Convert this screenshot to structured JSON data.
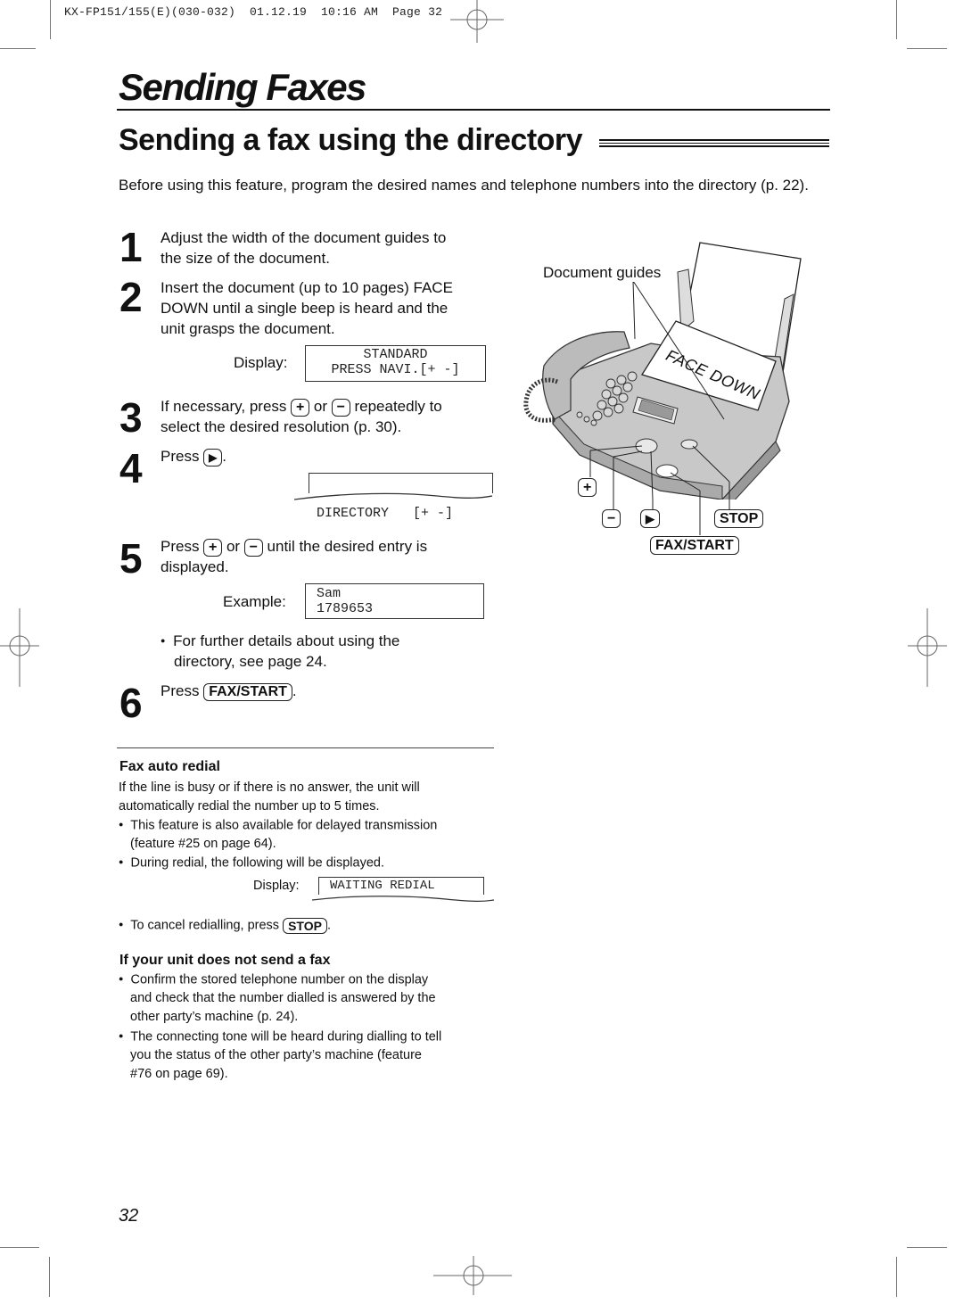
{
  "print_header": "KX-FP151/155(E)(030-032)  01.12.19  10:16 AM  Page 32",
  "page_title": "Sending Faxes",
  "section_title": "Sending a fax using the directory",
  "intro": "Before using this feature, program the desired names and telephone numbers into the directory (p. 22).",
  "steps": [
    {
      "number": "1",
      "text_lines": [
        "Adjust the width of the document guides to",
        "the size of the document."
      ]
    },
    {
      "number": "2",
      "text_lines": [
        "Insert the document (up to 10 pages) FACE",
        "DOWN until a single beep is heard and the",
        "unit grasps the document."
      ],
      "display_label": "Display:",
      "display_lines": [
        "STANDARD",
        "PRESS NAVI.[+ -]"
      ]
    },
    {
      "number": "3",
      "text_pre": "If necessary, press",
      "key1": "+",
      "text_mid": "or",
      "key2": "−",
      "text_post": "repeatedly to",
      "text_line2": "select the desired resolution (p. 30)."
    },
    {
      "number": "4",
      "text_pre": "Press",
      "key": "▶",
      "text_post": ".",
      "display_lines": [
        "DIRECTORY   [+ -]"
      ]
    },
    {
      "number": "5",
      "text_pre": "Press",
      "key1": "+",
      "text_mid": "or",
      "key2": "−",
      "text_post": "until the desired entry is",
      "text_line2": "displayed.",
      "example_label": "Example:",
      "display_lines": [
        "Sam",
        "1789653"
      ],
      "bullet_lines": [
        "For further details about using the",
        "directory, see page 24."
      ]
    },
    {
      "number": "6",
      "text_pre": "Press",
      "key": "FAX/START",
      "text_post": "."
    }
  ],
  "figure": {
    "callout_document_guides": "Document guides",
    "paper_text": "FACE DOWN",
    "keys": {
      "plus": "+",
      "minus": "−",
      "navi_right": "▶",
      "stop": "STOP",
      "fax_start": "FAX/START"
    }
  },
  "fax_auto_redial": {
    "heading": "Fax auto redial",
    "body_lines": [
      "If the line is busy or if there is no answer, the unit will",
      "automatically redial the number up to 5 times."
    ],
    "bullet1_lines": [
      "This feature is also available for delayed transmission",
      "(feature #25 on page 64)."
    ],
    "bullet2": "During redial, the following will be displayed.",
    "display_label": "Display:",
    "display_text": "WAITING REDIAL",
    "bullet3_pre": "To cancel redialling, press",
    "bullet3_key": "STOP",
    "bullet3_post": "."
  },
  "troubleshoot": {
    "heading": "If your unit does not send a fax",
    "bullet1_lines": [
      "Confirm the stored telephone number on the display",
      "and check that the number dialled is answered by the",
      "other party’s machine (p. 24)."
    ],
    "bullet2_lines": [
      "The connecting tone will be heard during dialling to tell",
      "you the status of the other party’s machine (feature",
      "#76 on page 69)."
    ]
  },
  "page_number": "32"
}
